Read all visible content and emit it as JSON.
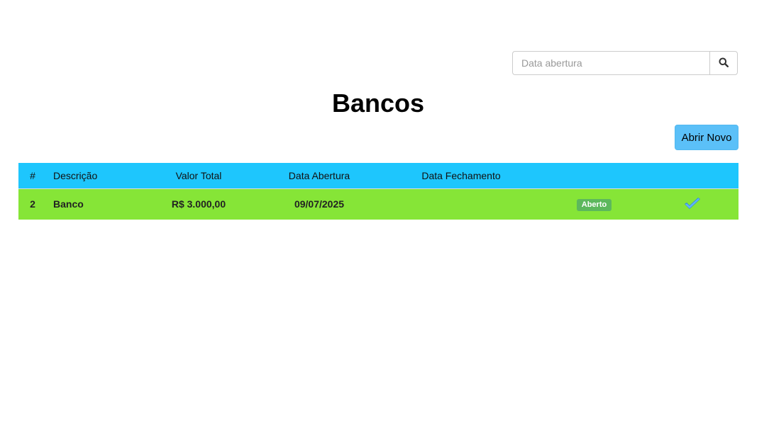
{
  "search": {
    "placeholder": "Data abertura",
    "value": "",
    "button_icon": "search-icon"
  },
  "page": {
    "title": "Bancos"
  },
  "toolbar": {
    "new_label": "Abrir Novo"
  },
  "table": {
    "columns": [
      "#",
      "Descrição",
      "Valor Total",
      "Data Abertura",
      "Data Fechamento",
      "",
      ""
    ],
    "rows": [
      {
        "id": "2",
        "descricao": "Banco",
        "valor_total": "R$ 3.000,00",
        "data_abertura": "09/07/2025",
        "data_fechamento": "",
        "status": "Aberto",
        "action_icon": "check-icon"
      }
    ]
  },
  "colors": {
    "header_bg": "#1ec6fd",
    "row_bg": "#86e537",
    "new_button_bg": "#5bc0f8",
    "badge_bg": "#5cb85c",
    "check_icon": "#2196f3"
  }
}
